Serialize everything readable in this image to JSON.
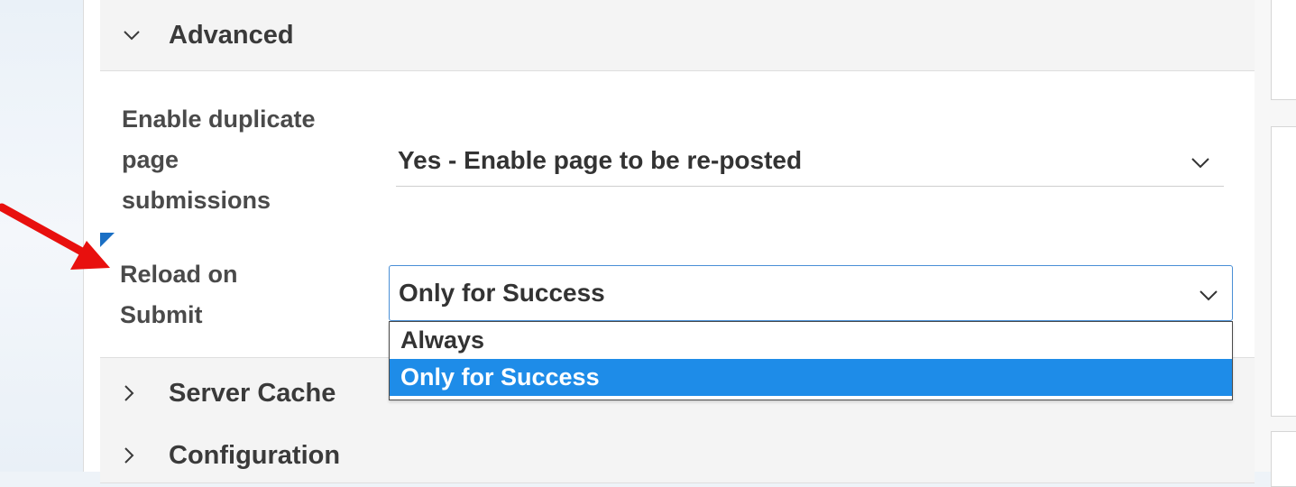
{
  "sections": {
    "advanced": {
      "label": "Advanced",
      "expanded": true
    },
    "server_cache": {
      "label": "Server Cache",
      "expanded": false
    },
    "configuration": {
      "label": "Configuration",
      "expanded": false
    }
  },
  "fields": {
    "duplicate_submissions": {
      "label": "Enable duplicate page submissions",
      "label_lines": [
        "Enable duplicate",
        "page",
        "submissions"
      ],
      "value": "Yes - Enable page to be re-posted"
    },
    "reload_on_submit": {
      "label": "Reload on Submit",
      "label_lines": [
        "Reload on",
        "Submit"
      ],
      "value": "Only for Success",
      "options": [
        "Always",
        "Only for Success"
      ],
      "selected_option": "Only for Success"
    }
  },
  "colors": {
    "highlight": "#1e8ce8",
    "focus_border": "#4a8fd6",
    "annotation_arrow": "#e8100e",
    "corner_marker": "#1a6fc4"
  },
  "icons": {
    "expanded": "chevron-down-icon",
    "collapsed": "chevron-right-icon",
    "select": "chevron-down-icon",
    "annotation": "red-arrow-icon"
  }
}
